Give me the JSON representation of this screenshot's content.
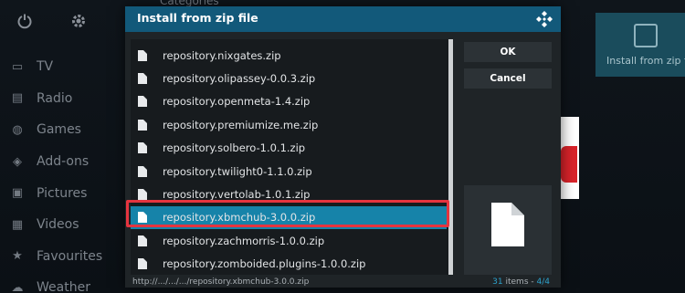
{
  "background": {
    "categories_label": "Categories",
    "menu": [
      {
        "icon": "tv-icon",
        "label": "TV"
      },
      {
        "icon": "radio-icon",
        "label": "Radio"
      },
      {
        "icon": "games-icon",
        "label": "Games"
      },
      {
        "icon": "addons-icon",
        "label": "Add-ons"
      },
      {
        "icon": "pictures-icon",
        "label": "Pictures"
      },
      {
        "icon": "videos-icon",
        "label": "Videos"
      },
      {
        "icon": "favourites-icon",
        "label": "Favourites"
      },
      {
        "icon": "weather-icon",
        "label": "Weather"
      }
    ],
    "right_tile_label": "Install from zip fi"
  },
  "dialog": {
    "title": "Install from zip file",
    "files": [
      "repository.nixgates.zip",
      "repository.olipassey-0.0.3.zip",
      "repository.openmeta-1.4.zip",
      "repository.premiumize.me.zip",
      "repository.solbero-1.0.1.zip",
      "repository.twilight0-1.1.0.zip",
      "repository.vertolab-1.0.1.zip",
      "repository.xbmchub-3.0.0.zip",
      "repository.zachmorris-1.0.0.zip",
      "repository.zomboided.plugins-1.0.0.zip"
    ],
    "selected_index": 7,
    "ok_label": "OK",
    "cancel_label": "Cancel",
    "footer_path": "http://.../.../.../repository.xbmchub-3.0.0.zip",
    "items_count": "31",
    "items_word": "items",
    "page_indicator": "4/4"
  },
  "colors": {
    "header": "#12597a",
    "selected": "#1683a9",
    "highlight_outline": "#e5343f"
  }
}
